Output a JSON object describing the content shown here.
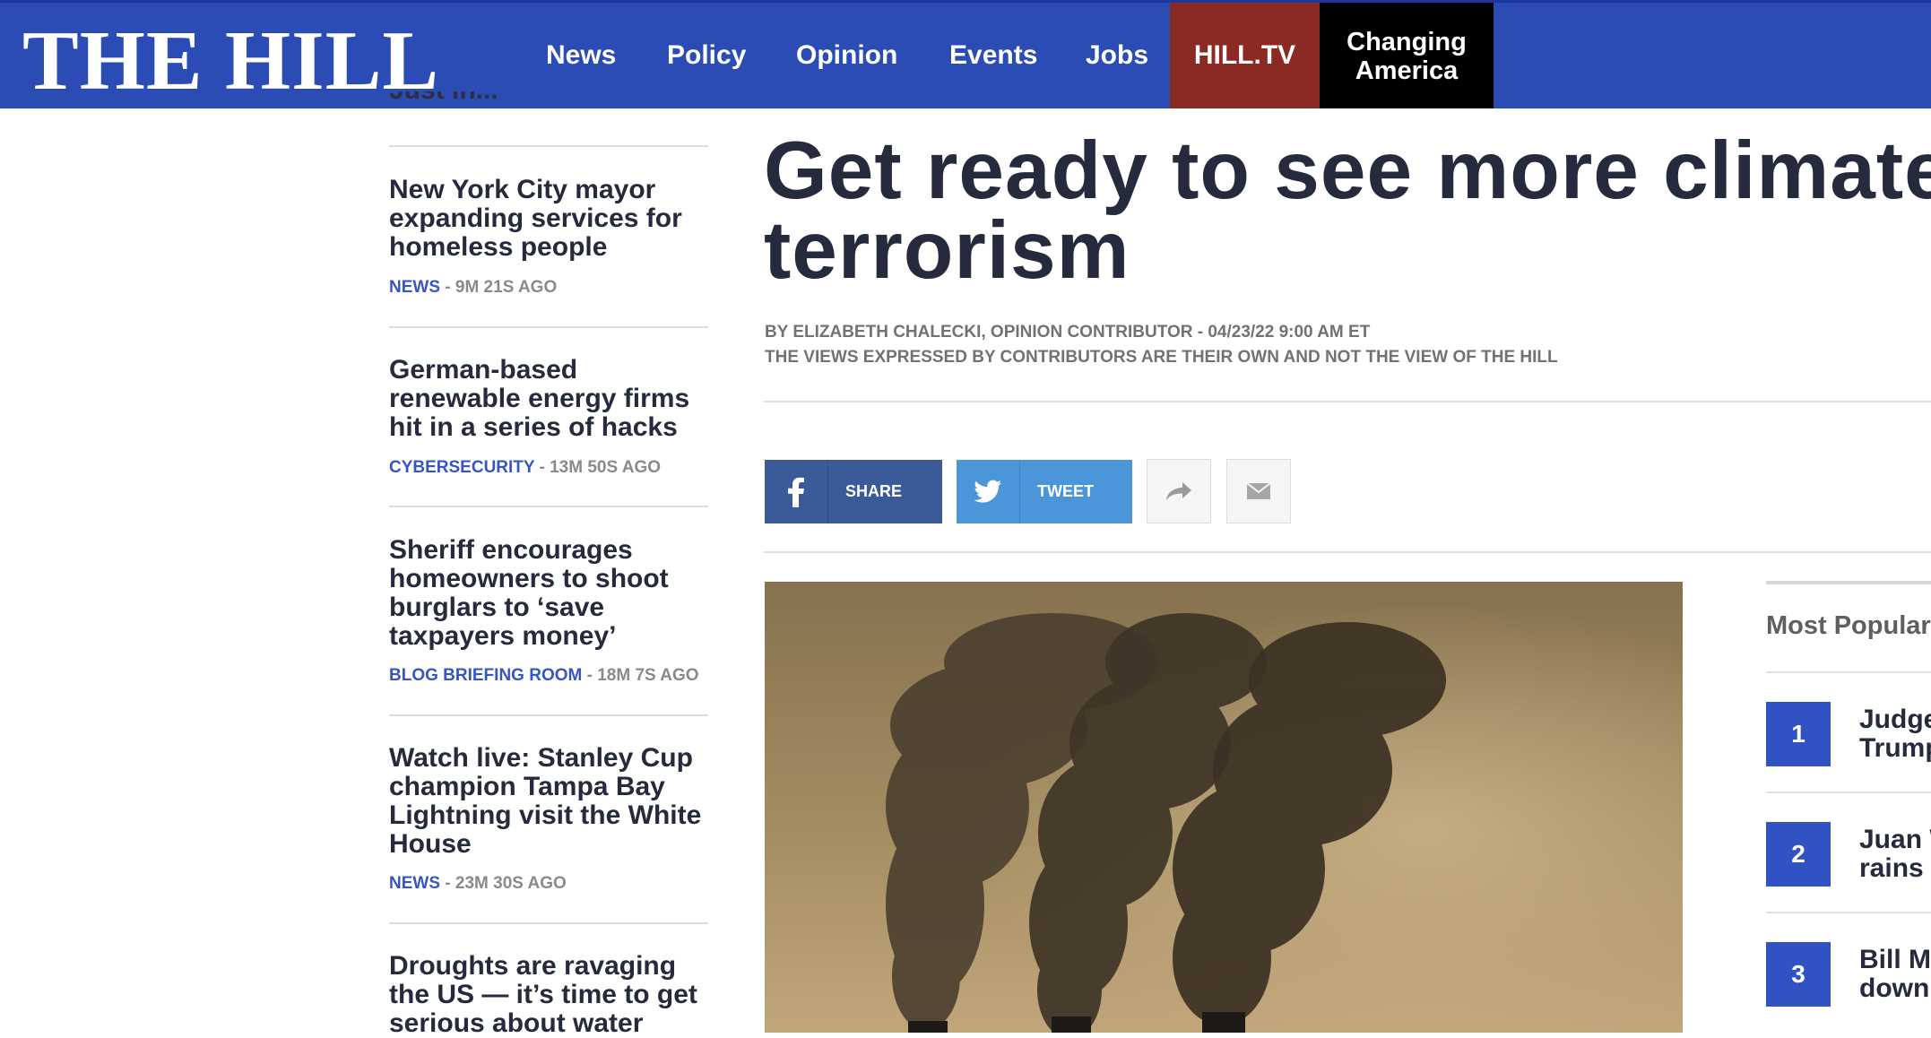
{
  "header": {
    "logo": "THE HILL",
    "nav": [
      "News",
      "Policy",
      "Opinion",
      "Events",
      "Jobs"
    ],
    "hilltv": "HILL.TV",
    "changing_line1": "Changing",
    "changing_line2": "America",
    "colors": {
      "bar": "#2c4cb5",
      "hilltv": "#8a2a22",
      "changing": "#000000"
    }
  },
  "rail": {
    "cut_heading": "Just In...",
    "items": [
      {
        "title": "New York City mayor expanding services for homeless people",
        "category": "NEWS",
        "time": " - 9M 21S AGO"
      },
      {
        "title": "German-based renewable energy firms hit in a series of hacks",
        "category": "CYBERSECURITY",
        "time": " - 13M 50S AGO"
      },
      {
        "title": "Sheriff encourages homeowners to shoot burglars to ‘save taxpayers money’",
        "category": "BLOG BRIEFING ROOM",
        "time": " - 18M 7S AGO"
      },
      {
        "title": "Watch live: Stanley Cup champion Tampa Bay Lightning visit the White House",
        "category": "NEWS",
        "time": " - 23M 30S AGO"
      },
      {
        "title": "Droughts are ravaging the US — it’s time to get serious about water"
      }
    ]
  },
  "article": {
    "headline_line1": "Get ready to see more climate",
    "headline_line2": "terrorism",
    "byline": "BY ELIZABETH CHALECKI, OPINION CONTRIBUTOR - 04/23/22 9:00 AM ET",
    "views": "THE VIEWS EXPRESSED BY CONTRIBUTORS ARE THEIR OWN AND NOT THE VIEW OF THE HILL",
    "share_label": "SHARE",
    "tweet_label": "TWEET"
  },
  "most_popular": {
    "title": "Most Popular",
    "items": [
      {
        "num": "1",
        "line1": "Judge",
        "line2": "Trump"
      },
      {
        "num": "2",
        "line1": "Juan W",
        "line2": "rains"
      },
      {
        "num": "3",
        "line1": "Bill M",
        "line2": "down"
      }
    ]
  }
}
